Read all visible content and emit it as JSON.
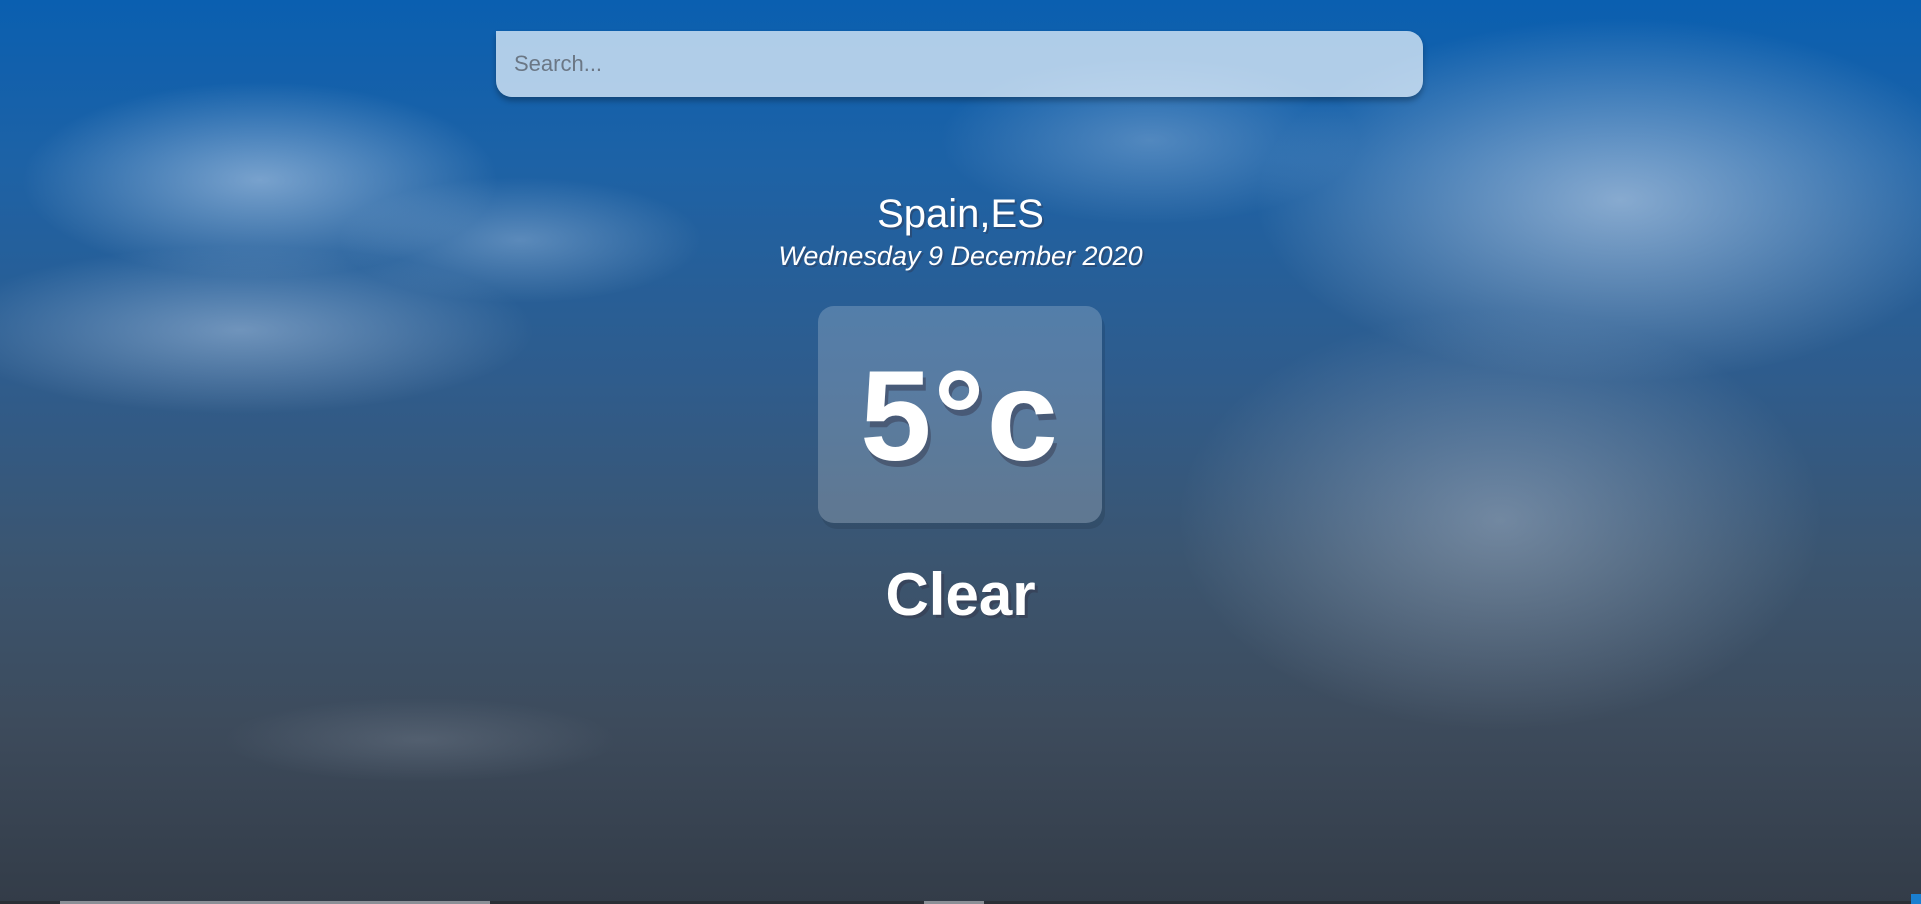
{
  "search": {
    "placeholder": "Search...",
    "value": ""
  },
  "location": {
    "name": "Spain,ES",
    "date": "Wednesday 9 December 2020"
  },
  "weather": {
    "temperature": "5°c",
    "condition": "Clear"
  },
  "colors": {
    "sky_top": "#0a5fb0",
    "sky_bottom": "#333c48",
    "text": "#ffffff"
  }
}
